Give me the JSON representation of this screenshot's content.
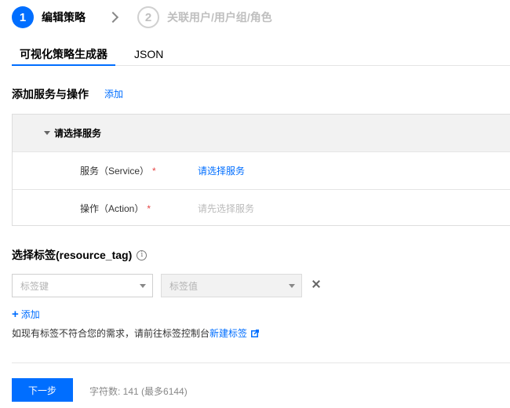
{
  "steps": [
    {
      "number": "1",
      "label": "编辑策略",
      "state": "active"
    },
    {
      "number": "2",
      "label": "关联用户/用户组/角色",
      "state": "inactive"
    }
  ],
  "tabs": {
    "visual": "可视化策略生成器",
    "json": "JSON"
  },
  "services_section": {
    "title": "添加服务与操作",
    "add_link": "添加",
    "panel": {
      "header": "请选择服务",
      "service_label": "服务（Service）",
      "service_value": "请选择服务",
      "action_label": "操作（Action）",
      "action_value": "请先选择服务",
      "required_mark": "*"
    }
  },
  "tag_section": {
    "title": "选择标签(resource_tag)",
    "info_icon_glyph": "i",
    "tag_key_placeholder": "标签键",
    "tag_value_placeholder": "标签值",
    "add_label": "添加",
    "hint_text": "如现有标签不符合您的需求，请前往标签控制台",
    "hint_link": "新建标签"
  },
  "footer": {
    "next_button": "下一步",
    "char_count": "字符数: 141 (最多6144)"
  },
  "colors": {
    "primary": "#006eff",
    "required": "#e54545"
  }
}
